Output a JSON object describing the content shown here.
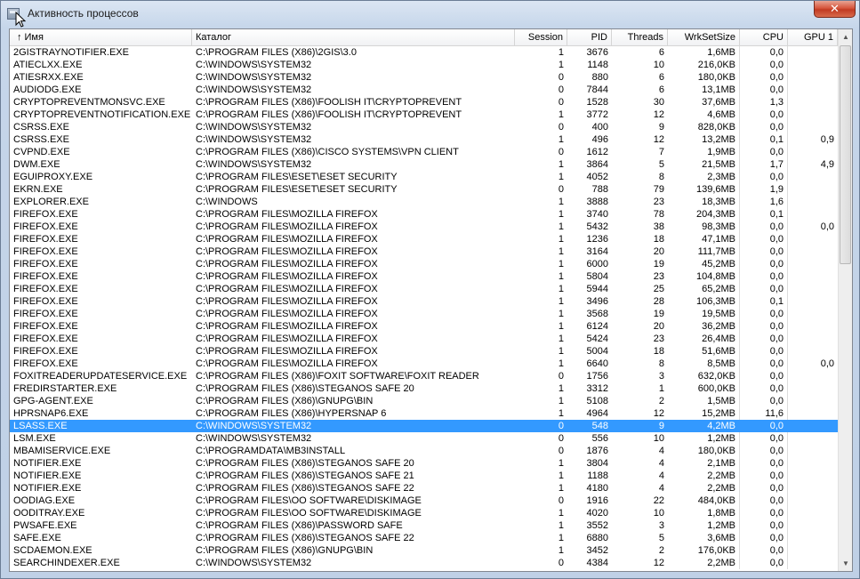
{
  "window": {
    "title": "Активность процессов",
    "close_label": "✕"
  },
  "columns": [
    {
      "key": "name",
      "label": "Имя",
      "sort_icon": "↑"
    },
    {
      "key": "dir",
      "label": "Каталог"
    },
    {
      "key": "session",
      "label": "Session"
    },
    {
      "key": "pid",
      "label": "PID"
    },
    {
      "key": "threads",
      "label": "Threads"
    },
    {
      "key": "ws",
      "label": "WrkSetSize"
    },
    {
      "key": "cpu",
      "label": "CPU"
    },
    {
      "key": "gpu",
      "label": "GPU 1"
    }
  ],
  "selected_row": 30,
  "rows": [
    [
      "2GISTRAYNOTIFIER.EXE",
      "C:\\PROGRAM FILES (X86)\\2GIS\\3.0",
      "1",
      "3676",
      "6",
      "1,6MB",
      "0,0",
      ""
    ],
    [
      "ATIECLXX.EXE",
      "C:\\WINDOWS\\SYSTEM32",
      "1",
      "1148",
      "10",
      "216,0KB",
      "0,0",
      ""
    ],
    [
      "ATIESRXX.EXE",
      "C:\\WINDOWS\\SYSTEM32",
      "0",
      "880",
      "6",
      "180,0KB",
      "0,0",
      ""
    ],
    [
      "AUDIODG.EXE",
      "C:\\WINDOWS\\SYSTEM32",
      "0",
      "7844",
      "6",
      "13,1MB",
      "0,0",
      ""
    ],
    [
      "CRYPTOPREVENTMONSVC.EXE",
      "C:\\PROGRAM FILES (X86)\\FOOLISH IT\\CRYPTOPREVENT",
      "0",
      "1528",
      "30",
      "37,6MB",
      "1,3",
      ""
    ],
    [
      "CRYPTOPREVENTNOTIFICATION.EXE",
      "C:\\PROGRAM FILES (X86)\\FOOLISH IT\\CRYPTOPREVENT",
      "1",
      "3772",
      "12",
      "4,6MB",
      "0,0",
      ""
    ],
    [
      "CSRSS.EXE",
      "C:\\WINDOWS\\SYSTEM32",
      "0",
      "400",
      "9",
      "828,0KB",
      "0,0",
      ""
    ],
    [
      "CSRSS.EXE",
      "C:\\WINDOWS\\SYSTEM32",
      "1",
      "496",
      "12",
      "13,2MB",
      "0,1",
      "0,9"
    ],
    [
      "CVPND.EXE",
      "C:\\PROGRAM FILES (X86)\\CISCO SYSTEMS\\VPN CLIENT",
      "0",
      "1612",
      "7",
      "1,9MB",
      "0,0",
      ""
    ],
    [
      "DWM.EXE",
      "C:\\WINDOWS\\SYSTEM32",
      "1",
      "3864",
      "5",
      "21,5MB",
      "1,7",
      "4,9"
    ],
    [
      "EGUIPROXY.EXE",
      "C:\\PROGRAM FILES\\ESET\\ESET SECURITY",
      "1",
      "4052",
      "8",
      "2,3MB",
      "0,0",
      ""
    ],
    [
      "EKRN.EXE",
      "C:\\PROGRAM FILES\\ESET\\ESET SECURITY",
      "0",
      "788",
      "79",
      "139,6MB",
      "1,9",
      ""
    ],
    [
      "EXPLORER.EXE",
      "C:\\WINDOWS",
      "1",
      "3888",
      "23",
      "18,3MB",
      "1,6",
      ""
    ],
    [
      "FIREFOX.EXE",
      "C:\\PROGRAM FILES\\MOZILLA FIREFOX",
      "1",
      "3740",
      "78",
      "204,3MB",
      "0,1",
      ""
    ],
    [
      "FIREFOX.EXE",
      "C:\\PROGRAM FILES\\MOZILLA FIREFOX",
      "1",
      "5432",
      "38",
      "98,3MB",
      "0,0",
      "0,0"
    ],
    [
      "FIREFOX.EXE",
      "C:\\PROGRAM FILES\\MOZILLA FIREFOX",
      "1",
      "1236",
      "18",
      "47,1MB",
      "0,0",
      ""
    ],
    [
      "FIREFOX.EXE",
      "C:\\PROGRAM FILES\\MOZILLA FIREFOX",
      "1",
      "3164",
      "20",
      "111,7MB",
      "0,0",
      ""
    ],
    [
      "FIREFOX.EXE",
      "C:\\PROGRAM FILES\\MOZILLA FIREFOX",
      "1",
      "6000",
      "19",
      "45,2MB",
      "0,0",
      ""
    ],
    [
      "FIREFOX.EXE",
      "C:\\PROGRAM FILES\\MOZILLA FIREFOX",
      "1",
      "5804",
      "23",
      "104,8MB",
      "0,0",
      ""
    ],
    [
      "FIREFOX.EXE",
      "C:\\PROGRAM FILES\\MOZILLA FIREFOX",
      "1",
      "5944",
      "25",
      "65,2MB",
      "0,0",
      ""
    ],
    [
      "FIREFOX.EXE",
      "C:\\PROGRAM FILES\\MOZILLA FIREFOX",
      "1",
      "3496",
      "28",
      "106,3MB",
      "0,1",
      ""
    ],
    [
      "FIREFOX.EXE",
      "C:\\PROGRAM FILES\\MOZILLA FIREFOX",
      "1",
      "3568",
      "19",
      "19,5MB",
      "0,0",
      ""
    ],
    [
      "FIREFOX.EXE",
      "C:\\PROGRAM FILES\\MOZILLA FIREFOX",
      "1",
      "6124",
      "20",
      "36,2MB",
      "0,0",
      ""
    ],
    [
      "FIREFOX.EXE",
      "C:\\PROGRAM FILES\\MOZILLA FIREFOX",
      "1",
      "5424",
      "23",
      "26,4MB",
      "0,0",
      ""
    ],
    [
      "FIREFOX.EXE",
      "C:\\PROGRAM FILES\\MOZILLA FIREFOX",
      "1",
      "5004",
      "18",
      "51,6MB",
      "0,0",
      ""
    ],
    [
      "FIREFOX.EXE",
      "C:\\PROGRAM FILES\\MOZILLA FIREFOX",
      "1",
      "6640",
      "8",
      "8,5MB",
      "0,0",
      "0,0"
    ],
    [
      "FOXITREADERUPDATESERVICE.EXE",
      "C:\\PROGRAM FILES (X86)\\FOXIT SOFTWARE\\FOXIT READER",
      "0",
      "1756",
      "3",
      "632,0KB",
      "0,0",
      ""
    ],
    [
      "FREDIRSTARTER.EXE",
      "C:\\PROGRAM FILES (X86)\\STEGANOS SAFE 20",
      "1",
      "3312",
      "1",
      "600,0KB",
      "0,0",
      ""
    ],
    [
      "GPG-AGENT.EXE",
      "C:\\PROGRAM FILES (X86)\\GNUPG\\BIN",
      "1",
      "5108",
      "2",
      "1,5MB",
      "0,0",
      ""
    ],
    [
      "HPRSNAP6.EXE",
      "C:\\PROGRAM FILES (X86)\\HYPERSNAP 6",
      "1",
      "4964",
      "12",
      "15,2MB",
      "11,6",
      ""
    ],
    [
      "LSASS.EXE",
      "C:\\WINDOWS\\SYSTEM32",
      "0",
      "548",
      "9",
      "4,2MB",
      "0,0",
      ""
    ],
    [
      "LSM.EXE",
      "C:\\WINDOWS\\SYSTEM32",
      "0",
      "556",
      "10",
      "1,2MB",
      "0,0",
      ""
    ],
    [
      "MBAMISERVICE.EXE",
      "C:\\PROGRAMDATA\\MB3INSTALL",
      "0",
      "1876",
      "4",
      "180,0KB",
      "0,0",
      ""
    ],
    [
      "NOTIFIER.EXE",
      "C:\\PROGRAM FILES (X86)\\STEGANOS SAFE 20",
      "1",
      "3804",
      "4",
      "2,1MB",
      "0,0",
      ""
    ],
    [
      "NOTIFIER.EXE",
      "C:\\PROGRAM FILES (X86)\\STEGANOS SAFE 21",
      "1",
      "1188",
      "4",
      "2,2MB",
      "0,0",
      ""
    ],
    [
      "NOTIFIER.EXE",
      "C:\\PROGRAM FILES (X86)\\STEGANOS SAFE 22",
      "1",
      "4180",
      "4",
      "2,2MB",
      "0,0",
      ""
    ],
    [
      "OODIAG.EXE",
      "C:\\PROGRAM FILES\\OO SOFTWARE\\DISKIMAGE",
      "0",
      "1916",
      "22",
      "484,0KB",
      "0,0",
      ""
    ],
    [
      "OODITRAY.EXE",
      "C:\\PROGRAM FILES\\OO SOFTWARE\\DISKIMAGE",
      "1",
      "4020",
      "10",
      "1,8MB",
      "0,0",
      ""
    ],
    [
      "PWSAFE.EXE",
      "C:\\PROGRAM FILES (X86)\\PASSWORD SAFE",
      "1",
      "3552",
      "3",
      "1,2MB",
      "0,0",
      ""
    ],
    [
      "SAFE.EXE",
      "C:\\PROGRAM FILES (X86)\\STEGANOS SAFE 22",
      "1",
      "6880",
      "5",
      "3,6MB",
      "0,0",
      ""
    ],
    [
      "SCDAEMON.EXE",
      "C:\\PROGRAM FILES (X86)\\GNUPG\\BIN",
      "1",
      "3452",
      "2",
      "176,0KB",
      "0,0",
      ""
    ],
    [
      "SEARCHINDEXER.EXE",
      "C:\\WINDOWS\\SYSTEM32",
      "0",
      "4384",
      "12",
      "2,2MB",
      "0,0",
      ""
    ]
  ],
  "scrollbar": {
    "up_icon": "▲",
    "down_icon": "▼"
  }
}
